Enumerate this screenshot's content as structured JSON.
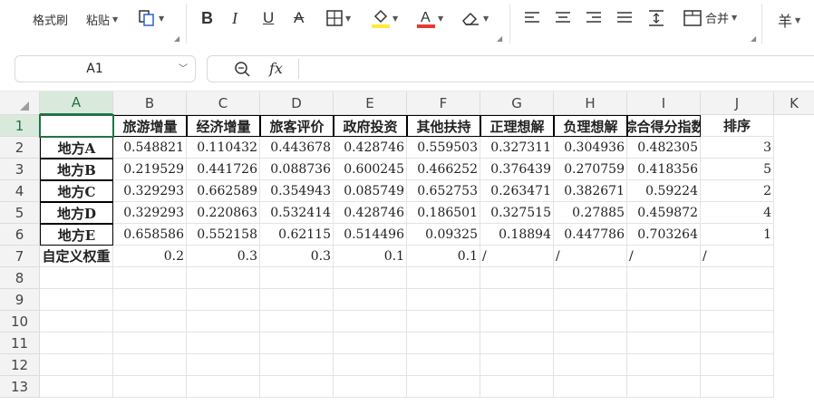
{
  "toolbar": {
    "format_painter": "格式刷",
    "paste": "粘贴",
    "merge": "合并",
    "currency": "羊"
  },
  "formula_bar": {
    "cell_ref": "A1",
    "fx_label": "fx",
    "formula": ""
  },
  "colors": {
    "accent": "#217346",
    "highlight": "#ffeb3b",
    "font_color": "#e53935"
  },
  "columns": [
    "A",
    "B",
    "C",
    "D",
    "E",
    "F",
    "G",
    "H",
    "I",
    "J",
    "K"
  ],
  "rows": [
    "1",
    "2",
    "3",
    "4",
    "5",
    "6",
    "7",
    "8",
    "9",
    "10",
    "11",
    "12",
    "13"
  ],
  "sheet": {
    "header": [
      "",
      "旅游增量",
      "经济增量",
      "旅客评价",
      "政府投资",
      "其他扶持",
      "正理想解",
      "负理想解",
      "综合得分指数",
      "排序"
    ],
    "data": [
      [
        "地方A",
        "0.548821",
        "0.110432",
        "0.443678",
        "0.428746",
        "0.559503",
        "0.327311",
        "0.304936",
        "0.482305",
        "3"
      ],
      [
        "地方B",
        "0.219529",
        "0.441726",
        "0.088736",
        "0.600245",
        "0.466252",
        "0.376439",
        "0.270759",
        "0.418356",
        "5"
      ],
      [
        "地方C",
        "0.329293",
        "0.662589",
        "0.354943",
        "0.085749",
        "0.652753",
        "0.263471",
        "0.382671",
        "0.59224",
        "2"
      ],
      [
        "地方D",
        "0.329293",
        "0.220863",
        "0.532414",
        "0.428746",
        "0.186501",
        "0.327515",
        "0.27885",
        "0.459872",
        "4"
      ],
      [
        "地方E",
        "0.658586",
        "0.552158",
        "0.62115",
        "0.514496",
        "0.09325",
        "0.18894",
        "0.447786",
        "0.703264",
        "1"
      ]
    ],
    "weights": [
      "自定义权重",
      "0.2",
      "0.3",
      "0.3",
      "0.1",
      "0.1",
      "/",
      "/",
      "/",
      "/"
    ]
  }
}
